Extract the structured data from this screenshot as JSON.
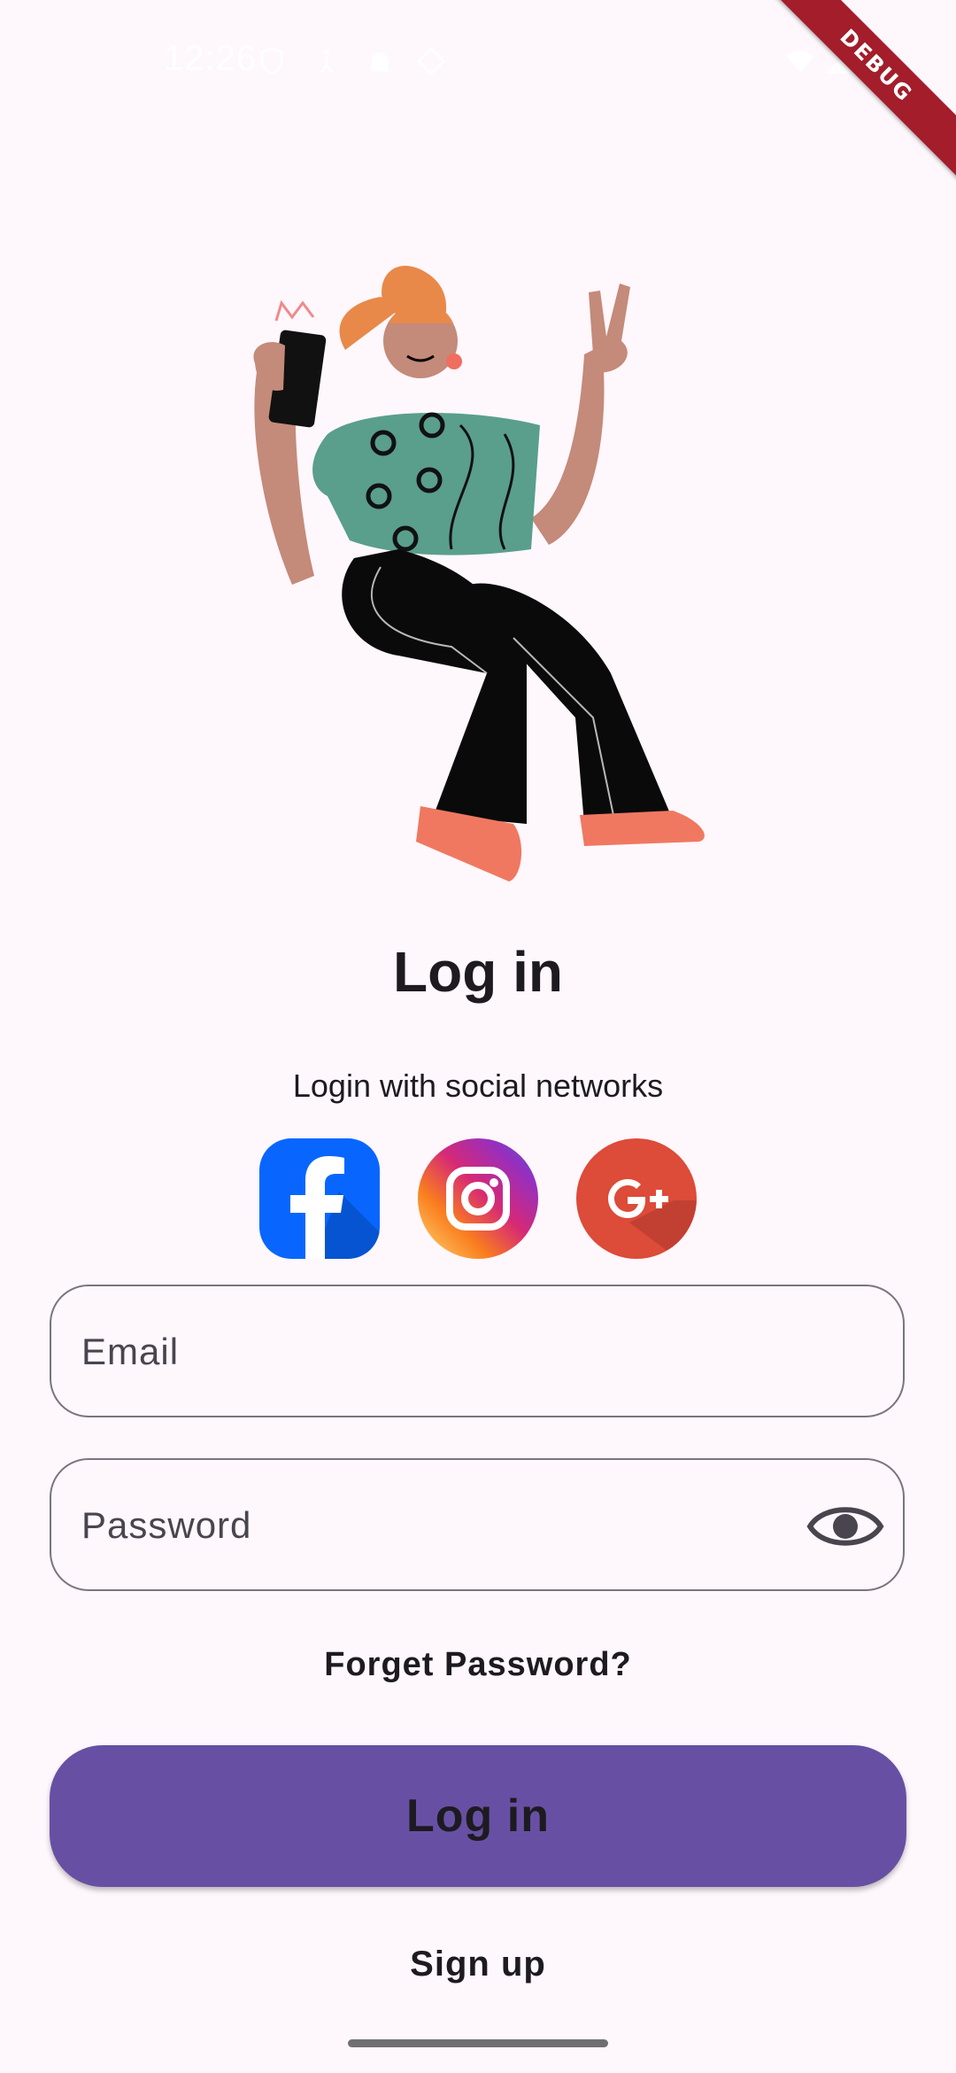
{
  "status_bar": {
    "time": "12:26",
    "debug_label": "DEBUG"
  },
  "login": {
    "title": "Log in",
    "social_label": "Login with social networks",
    "social_networks": [
      {
        "name": "Facebook",
        "icon": "facebook-icon",
        "color": "#0866ff"
      },
      {
        "name": "Instagram",
        "icon": "instagram-icon",
        "color": "#e1306c"
      },
      {
        "name": "Google Plus",
        "icon": "google-plus-icon",
        "color": "#dd4b39"
      }
    ],
    "email_placeholder": "Email",
    "password_placeholder": "Password",
    "forgot_password": "Forget Password?",
    "login_button": "Log in",
    "signup_link": "Sign up"
  },
  "colors": {
    "background": "#fef7fc",
    "primary": "#6750a4",
    "outline": "#79747e",
    "debug_banner": "#a31d2b"
  }
}
